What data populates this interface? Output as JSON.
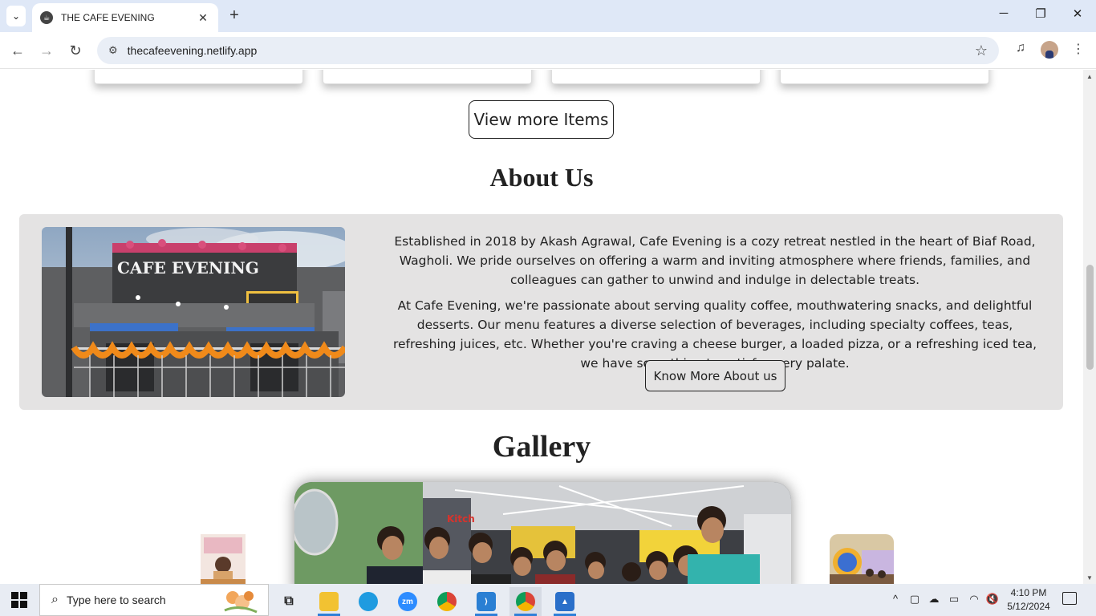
{
  "browser": {
    "tab_title": "THE CAFE EVENING",
    "url": "thecafeevening.netlify.app"
  },
  "page": {
    "view_more_label": "View more Items",
    "about": {
      "title": "About Us",
      "paragraph1": "Established in 2018 by Akash Agrawal, Cafe Evening is a cozy retreat nestled in the heart of Biaf Road, Wagholi. We pride ourselves on offering a warm and inviting atmosphere where friends, families, and colleagues can gather to unwind and indulge in delectable treats.",
      "paragraph2": "At Cafe Evening, we're passionate about serving quality coffee, mouthwatering snacks, and delightful desserts. Our menu features a diverse selection of beverages, including specialty coffees, teas, refreshing juices, etc. Whether you're craving a cheese burger, a loaded pizza, or a refreshing iced tea, we have something to satisfy every palate.",
      "button_label": "Know More About us",
      "storefront_sign": "CAFE EVENING"
    },
    "gallery": {
      "title": "Gallery",
      "wall_sign": "Kitch"
    }
  },
  "taskbar": {
    "search_placeholder": "Type here to search",
    "apps": [
      "task-view",
      "file-explorer",
      "edge",
      "zoom",
      "chrome",
      "vscode",
      "chrome",
      "photos"
    ],
    "time": "4:10 PM",
    "date": "5/12/2024"
  },
  "colors": {
    "tabbar_bg": "#dfe8f7",
    "about_bg": "#e4e3e3",
    "taskbar_bg": "#e8ecf3",
    "accent": "#2f80d8"
  }
}
